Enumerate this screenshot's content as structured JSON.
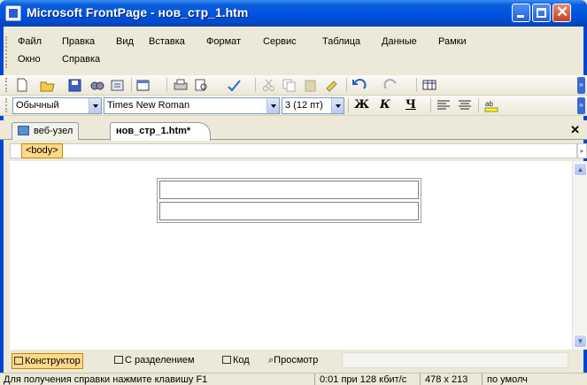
{
  "window": {
    "title": "Microsoft FrontPage - нов_стр_1.htm",
    "app_icon": "frontpage-app-icon"
  },
  "menu": {
    "row1": [
      "Файл",
      "Правка",
      "Вид",
      "Вставка",
      "Формат",
      "Сервис",
      "Таблица",
      "Данные",
      "Рамки"
    ],
    "row2": [
      "Окно",
      "Справка"
    ]
  },
  "standard_toolbar": {
    "icons": [
      "new-page-icon",
      "open-icon",
      "save-icon",
      "search-icon",
      "publish-icon",
      "insert-table-icon",
      "print-icon",
      "print-preview-icon",
      "spelling-icon",
      "cut-icon",
      "copy-icon",
      "paste-icon",
      "format-painter-icon",
      "undo-icon",
      "redo-icon",
      "grid-icon"
    ]
  },
  "format_toolbar": {
    "style_value": "Обычный",
    "font_value": "Times New Roman",
    "size_value": "3  (12 пт)",
    "bold_label": "Ж",
    "italic_label": "К",
    "underline_label": "Ч"
  },
  "tabs": {
    "site_tab": "веб-узел",
    "page_tab": "нов_стр_1.htm*"
  },
  "tag_selector": {
    "tag": "<body>"
  },
  "view_tabs": {
    "design": "Конструктор",
    "split": "С разделением",
    "code": "Код",
    "preview": "Просмотр"
  },
  "status": {
    "help": "Для получения справки нажмите клавишу F1",
    "download": "0:01 при 128 кбит/с",
    "size": "478 x 213",
    "mode": "по умолч"
  },
  "colors": {
    "titlebar": "#0054e3",
    "chrome": "#ece9d8",
    "highlight": "#ffd88a"
  }
}
